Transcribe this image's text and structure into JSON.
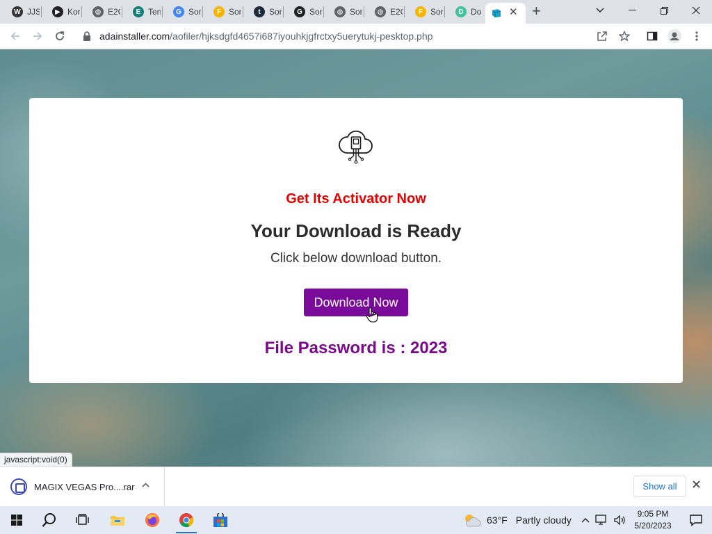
{
  "browser": {
    "tabs": [
      {
        "label": "JJS",
        "favicon": "jjs-icon",
        "color": "#333333"
      },
      {
        "label": "Kor",
        "favicon": "kor-icon",
        "color": "#202124"
      },
      {
        "label": "E2C",
        "favicon": "globe-icon",
        "color": "#5f6368"
      },
      {
        "label": "Ten",
        "favicon": "ten-icon",
        "color": "#147a7a"
      },
      {
        "label": "Sor",
        "favicon": "google-icon",
        "color": "#4285f4"
      },
      {
        "label": "Sor",
        "favicon": "f-icon",
        "color": "#f4b400"
      },
      {
        "label": "Sor",
        "favicon": "t-icon",
        "color": "#1e2b3a"
      },
      {
        "label": "Sor",
        "favicon": "g-icon",
        "color": "#202124"
      },
      {
        "label": "Sor",
        "favicon": "globe-icon",
        "color": "#5f6368"
      },
      {
        "label": "E2C",
        "favicon": "globe-icon",
        "color": "#5f6368"
      },
      {
        "label": "Sor",
        "favicon": "f-icon",
        "color": "#f4b400"
      },
      {
        "label": "Do",
        "favicon": "d-icon",
        "color": "#3ec29a"
      }
    ],
    "active_tab": {
      "favicon": "cube-icon",
      "color": "#1aa3c8"
    },
    "url_host": "adainstaller.com",
    "url_path": "/aofiler/hjksdgfd4657i687iyouhkjgfrctxy5uerytukj-pesktop.php"
  },
  "page": {
    "promo": "Get Its Activator Now",
    "heading": "Your Download is Ready",
    "subtext": "Click below download button.",
    "button_label": "Download Now",
    "password_text": "File Password is : 2023",
    "status_url": "javascript:void(0)",
    "colors": {
      "promo": "#e60000",
      "button": "#7a0a9a",
      "password": "#7a0a8a"
    }
  },
  "download_shelf": {
    "file_name": "MAGIX VEGAS Pro....rar",
    "show_all_label": "Show all"
  },
  "taskbar": {
    "weather_temp": "63°F",
    "weather_condition": "Partly cloudy",
    "time": "9:05 PM",
    "date": "5/20/2023"
  }
}
